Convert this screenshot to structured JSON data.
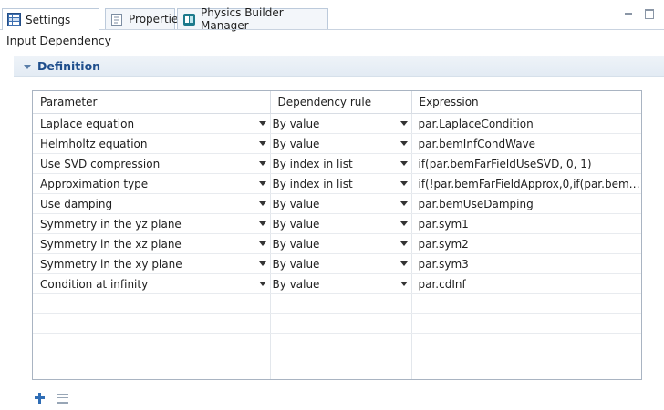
{
  "tabs": [
    {
      "label": "Settings",
      "icon": "settings-grid-icon",
      "active": true
    },
    {
      "label": "Properties",
      "icon": "properties-icon",
      "active": false
    },
    {
      "label": "Physics Builder Manager",
      "icon": "physics-builder-icon",
      "active": false
    }
  ],
  "panel": {
    "title": "Input Dependency"
  },
  "section": {
    "title": "Definition",
    "expanded": true
  },
  "table": {
    "headers": [
      "Parameter",
      "Dependency rule",
      "Expression"
    ],
    "rows": [
      {
        "parameter": "Laplace equation",
        "rule": "By value",
        "expression": "par.LaplaceCondition"
      },
      {
        "parameter": "Helmholtz equation",
        "rule": "By value",
        "expression": "par.bemInfCondWave"
      },
      {
        "parameter": "Use SVD compression",
        "rule": "By index in list",
        "expression": "if(par.bemFarFieldUseSVD, 0, 1)"
      },
      {
        "parameter": "Approximation type",
        "rule": "By index in list",
        "expression": "if(!par.bemFarFieldApprox,0,if(par.bemF..."
      },
      {
        "parameter": "Use damping",
        "rule": "By value",
        "expression": "par.bemUseDamping"
      },
      {
        "parameter": "Symmetry in the yz plane",
        "rule": "By value",
        "expression": "par.sym1"
      },
      {
        "parameter": "Symmetry in the xz plane",
        "rule": "By value",
        "expression": "par.sym2"
      },
      {
        "parameter": "Symmetry in the xy plane",
        "rule": "By value",
        "expression": "par.sym3"
      },
      {
        "parameter": "Condition at infinity",
        "rule": "By value",
        "expression": "par.cdInf"
      }
    ],
    "empty_rows": 5
  },
  "colors": {
    "accent": "#1f4e8c",
    "header_bg": "#e3ebf4",
    "border": "#a9b4c2"
  },
  "tools": [
    {
      "icon": "add-icon"
    },
    {
      "icon": "clear-table-icon"
    }
  ]
}
